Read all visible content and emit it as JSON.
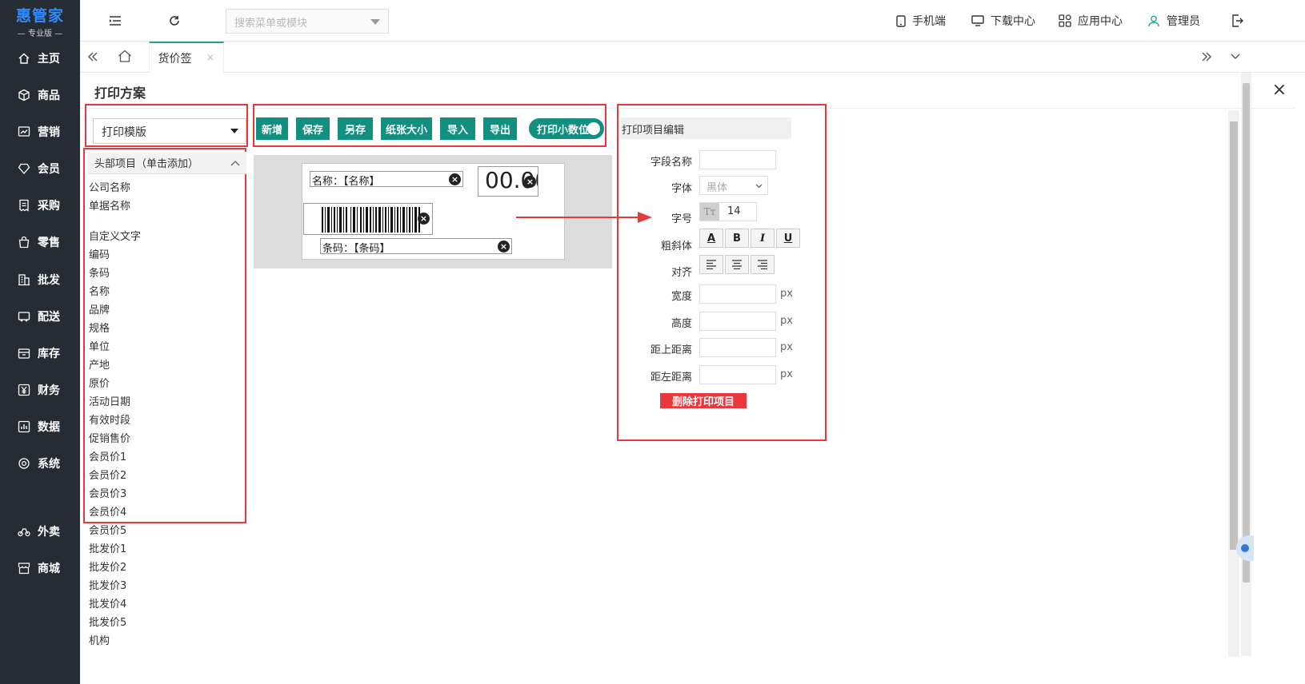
{
  "sidebar": {
    "logo_main": "惠管家",
    "logo_sub": "— 专业版 —",
    "items": [
      {
        "label": "主页",
        "icon": "home-icon"
      },
      {
        "label": "商品",
        "icon": "cube-icon"
      },
      {
        "label": "营销",
        "icon": "chart-icon"
      },
      {
        "label": "会员",
        "icon": "diamond-icon"
      },
      {
        "label": "采购",
        "icon": "receipt-icon"
      },
      {
        "label": "零售",
        "icon": "bag-icon"
      },
      {
        "label": "批发",
        "icon": "building-icon"
      },
      {
        "label": "配送",
        "icon": "truck-icon"
      },
      {
        "label": "库存",
        "icon": "box-icon"
      },
      {
        "label": "财务",
        "icon": "yen-icon"
      },
      {
        "label": "数据",
        "icon": "bar-chart-icon"
      },
      {
        "label": "系统",
        "icon": "gear-icon"
      },
      {
        "label": "外卖",
        "icon": "bike-icon"
      },
      {
        "label": "商城",
        "icon": "store-icon"
      }
    ]
  },
  "topbar": {
    "search_placeholder": "搜索菜单或模块",
    "mobile": "手机端",
    "download": "下载中心",
    "apps": "应用中心",
    "user": "管理员"
  },
  "tabs": {
    "active": "货价签",
    "close": "×"
  },
  "dialog": {
    "title": "打印方案",
    "template_select": "打印模版",
    "fields_header": "头部项目（单击添加）",
    "fields": [
      "公司名称",
      "单据名称",
      "",
      "自定义文字",
      "编码",
      "条码",
      "名称",
      "品牌",
      "规格",
      "单位",
      "产地",
      "原价",
      "活动日期",
      "有效时段",
      "促销售价",
      "会员价1",
      "会员价2",
      "会员价3",
      "会员价4",
      "会员价5",
      "批发价1",
      "批发价2",
      "批发价3",
      "批发价4",
      "批发价5",
      "机构"
    ],
    "buttons": {
      "add": "新增",
      "save": "保存",
      "save_as": "另存",
      "paper_size": "纸张大小",
      "import": "导入",
      "export": "导出",
      "decimal_toggle": "打印小数位"
    },
    "canvas": {
      "name_item": "名称：【名称】",
      "price_item": "00.00",
      "barcode_item": "条码：【条码】"
    },
    "editor": {
      "title": "打印项目编辑",
      "field_name_label": "字段名称",
      "field_name_value": "",
      "font_label": "字体",
      "font_value": "黑体",
      "size_label": "字号",
      "size_value": "14",
      "style_label": "粗斜体",
      "style_buttons": [
        "A",
        "B",
        "I",
        "U"
      ],
      "align_label": "对齐",
      "width_label": "宽度",
      "height_label": "高度",
      "top_label": "距上距离",
      "left_label": "距左距离",
      "unit": "px",
      "delete": "删除打印项目"
    }
  },
  "colors": {
    "sidebar_bg": "#262c33",
    "primary_green": "#128f7f",
    "highlight_red": "#e8383d",
    "logo_blue": "#2f8cff"
  }
}
